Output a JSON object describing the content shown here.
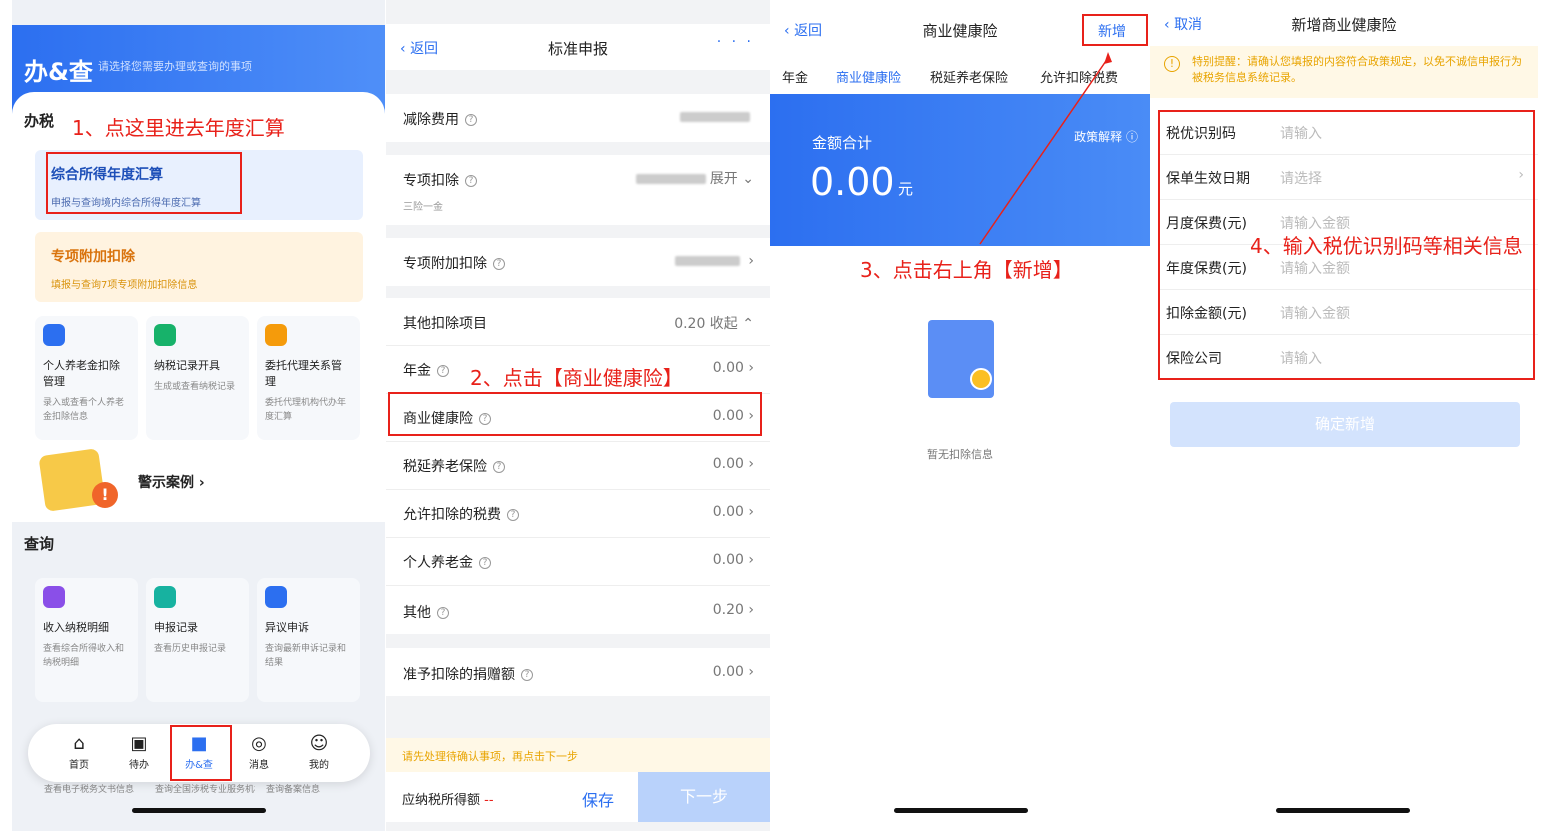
{
  "p1": {
    "brand": "办&查",
    "hint": "请选择您需要办理或查询的事项",
    "sec_tax": "办税",
    "ann1": "1、点这里进去年度汇算",
    "t1_title": "综合所得年度汇算",
    "t1_sub": "申报与查询境内综合所得年度汇算",
    "t2_title": "专项附加扣除",
    "t2_sub": "填报与查询7项专项附加扣除信息",
    "tiles": [
      {
        "t": "个人养老金扣除管理",
        "s": "录入或查看个人养老金扣除信息"
      },
      {
        "t": "纳税记录开具",
        "s": "生成或查看纳税记录"
      },
      {
        "t": "委托代理关系管理",
        "s": "委托代理机构代办年度汇算"
      }
    ],
    "warn_case": "警示案例",
    "sec_query": "查询",
    "qtiles": [
      {
        "t": "收入纳税明细",
        "s": "查看综合所得收入和纳税明细"
      },
      {
        "t": "申报记录",
        "s": "查看历史申报记录"
      },
      {
        "t": "异议申诉",
        "s": "查询最新申诉记录和结果"
      }
    ],
    "behind": [
      "查看电子税务文书信息",
      "查询全国涉税专业服务机构信息",
      "查询备案信息"
    ],
    "nav": [
      "首页",
      "待办",
      "办&查",
      "消息",
      "我的"
    ]
  },
  "p2": {
    "back": "返回",
    "title": "标准申报",
    "more": "· · ·",
    "r_reduce": "减除费用",
    "r_special": "专项扣除",
    "r_special_sub": "三险一金",
    "r_special_val": "展开",
    "r_add": "专项附加扣除",
    "r_other": "其他扣除项目",
    "r_other_val": "0.20 收起",
    "items": [
      {
        "l": "年金",
        "v": "0.00"
      },
      {
        "l": "商业健康险",
        "v": "0.00"
      },
      {
        "l": "税延养老保险",
        "v": "0.00"
      },
      {
        "l": "允许扣除的税费",
        "v": "0.00"
      },
      {
        "l": "个人养老金",
        "v": "0.00"
      },
      {
        "l": "其他",
        "v": "0.20"
      }
    ],
    "donation": "准予扣除的捐赠额",
    "donation_val": "0.00",
    "ann2": "2、点击【商业健康险】",
    "notice": "请先处理待确认事项，再点击下一步",
    "payable": "应纳税所得额",
    "payable_val": "--",
    "save": "保存",
    "next": "下一步"
  },
  "p3": {
    "back": "返回",
    "title": "商业健康险",
    "add": "新增",
    "tabs": [
      "年金",
      "商业健康险",
      "税延养老保险",
      "允许扣除税费"
    ],
    "sum_label": "金额合计",
    "policy": "政策解释",
    "amount": "0.00",
    "unit": "元",
    "ann3": "3、点击右上角【新增】",
    "empty": "暂无扣除信息"
  },
  "p4": {
    "cancel": "取消",
    "title": "新增商业健康险",
    "warn": "特别提醒：请确认您填报的内容符合政策规定，以免不诚信申报行为被税务信息系统记录。",
    "fields": [
      {
        "l": "税优识别码",
        "p": "请输入"
      },
      {
        "l": "保单生效日期",
        "p": "请选择"
      },
      {
        "l": "月度保费(元)",
        "p": "请输入金额"
      },
      {
        "l": "年度保费(元)",
        "p": "请输入金额"
      },
      {
        "l": "扣除金额(元)",
        "p": "请输入金额"
      },
      {
        "l": "保险公司",
        "p": "请输入"
      }
    ],
    "ann4": "4、输入税优识别码等相关信息",
    "confirm": "确定新增"
  }
}
